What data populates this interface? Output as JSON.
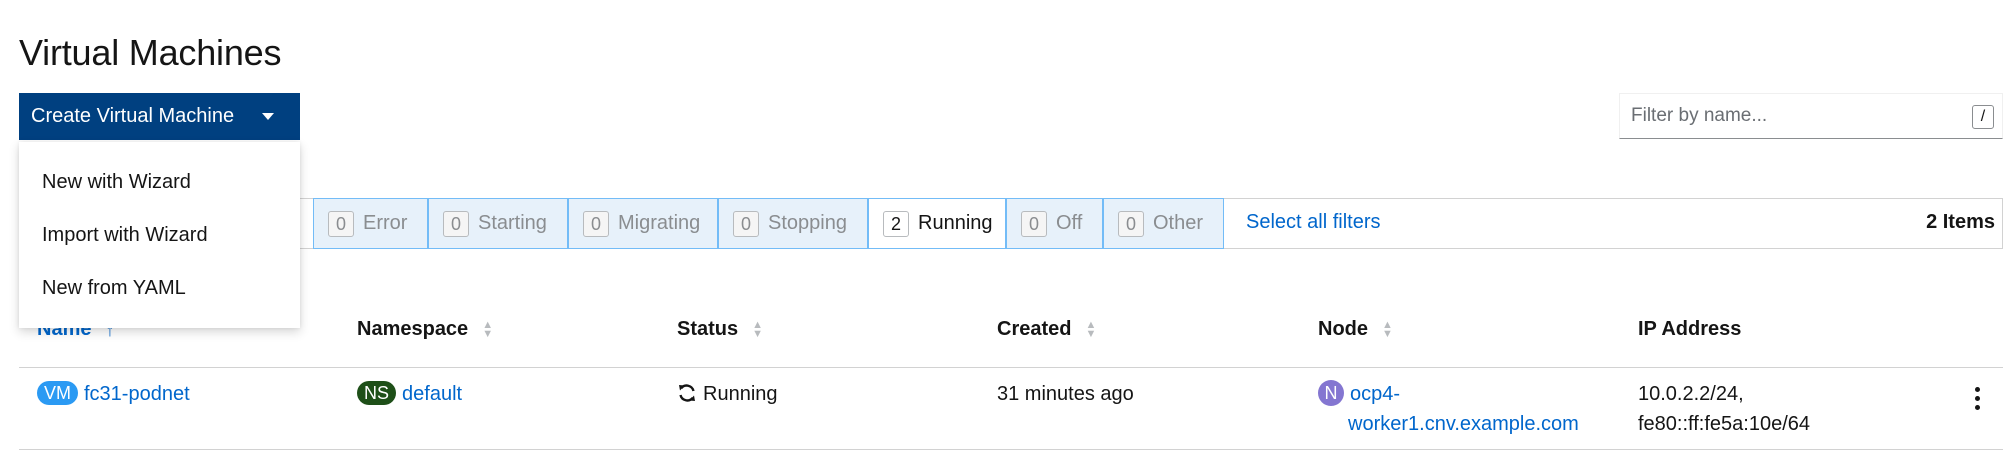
{
  "page": {
    "title": "Virtual Machines"
  },
  "toolbar": {
    "create_label": "Create Virtual Machine",
    "filter_placeholder": "Filter by name...",
    "filter_shortcut": "/"
  },
  "dropdown": {
    "items": [
      {
        "label": "New with Wizard"
      },
      {
        "label": "Import with Wizard"
      },
      {
        "label": "New from YAML"
      }
    ]
  },
  "status_filters": [
    {
      "label": "Error",
      "count": "0",
      "active": false
    },
    {
      "label": "Starting",
      "count": "0",
      "active": false
    },
    {
      "label": "Migrating",
      "count": "0",
      "active": false
    },
    {
      "label": "Stopping",
      "count": "0",
      "active": false
    },
    {
      "label": "Running",
      "count": "2",
      "active": true
    },
    {
      "label": "Off",
      "count": "0",
      "active": false
    },
    {
      "label": "Other",
      "count": "0",
      "active": false
    }
  ],
  "filter_bar": {
    "select_all": "Select all filters",
    "items_count": "2 Items"
  },
  "table": {
    "columns": [
      "Name",
      "Namespace",
      "Status",
      "Created",
      "Node",
      "IP Address"
    ],
    "rows": [
      {
        "name_badge": "VM",
        "name": "fc31-podnet",
        "namespace_badge": "NS",
        "namespace": "default",
        "status": "Running",
        "created": "31 minutes ago",
        "node_badge": "N",
        "node_line1": "ocp4-",
        "node_line2": "worker1.cnv.example.com",
        "ip_line1": "10.0.2.2/24,",
        "ip_line2": "fe80::ff:fe5a:10e/64"
      }
    ]
  },
  "colors": {
    "primary": "#004080",
    "link": "#0066cc",
    "chip_bg": "#e7f1fa",
    "chip_border": "#73bcf7",
    "vm_badge": "#2b9af3",
    "ns_badge": "#1e4f18",
    "node_badge": "#8476d1"
  },
  "icons": {
    "status_running": "refresh-icon",
    "row_actions": "kebab-icon",
    "create_caret": "caret-down-icon"
  }
}
